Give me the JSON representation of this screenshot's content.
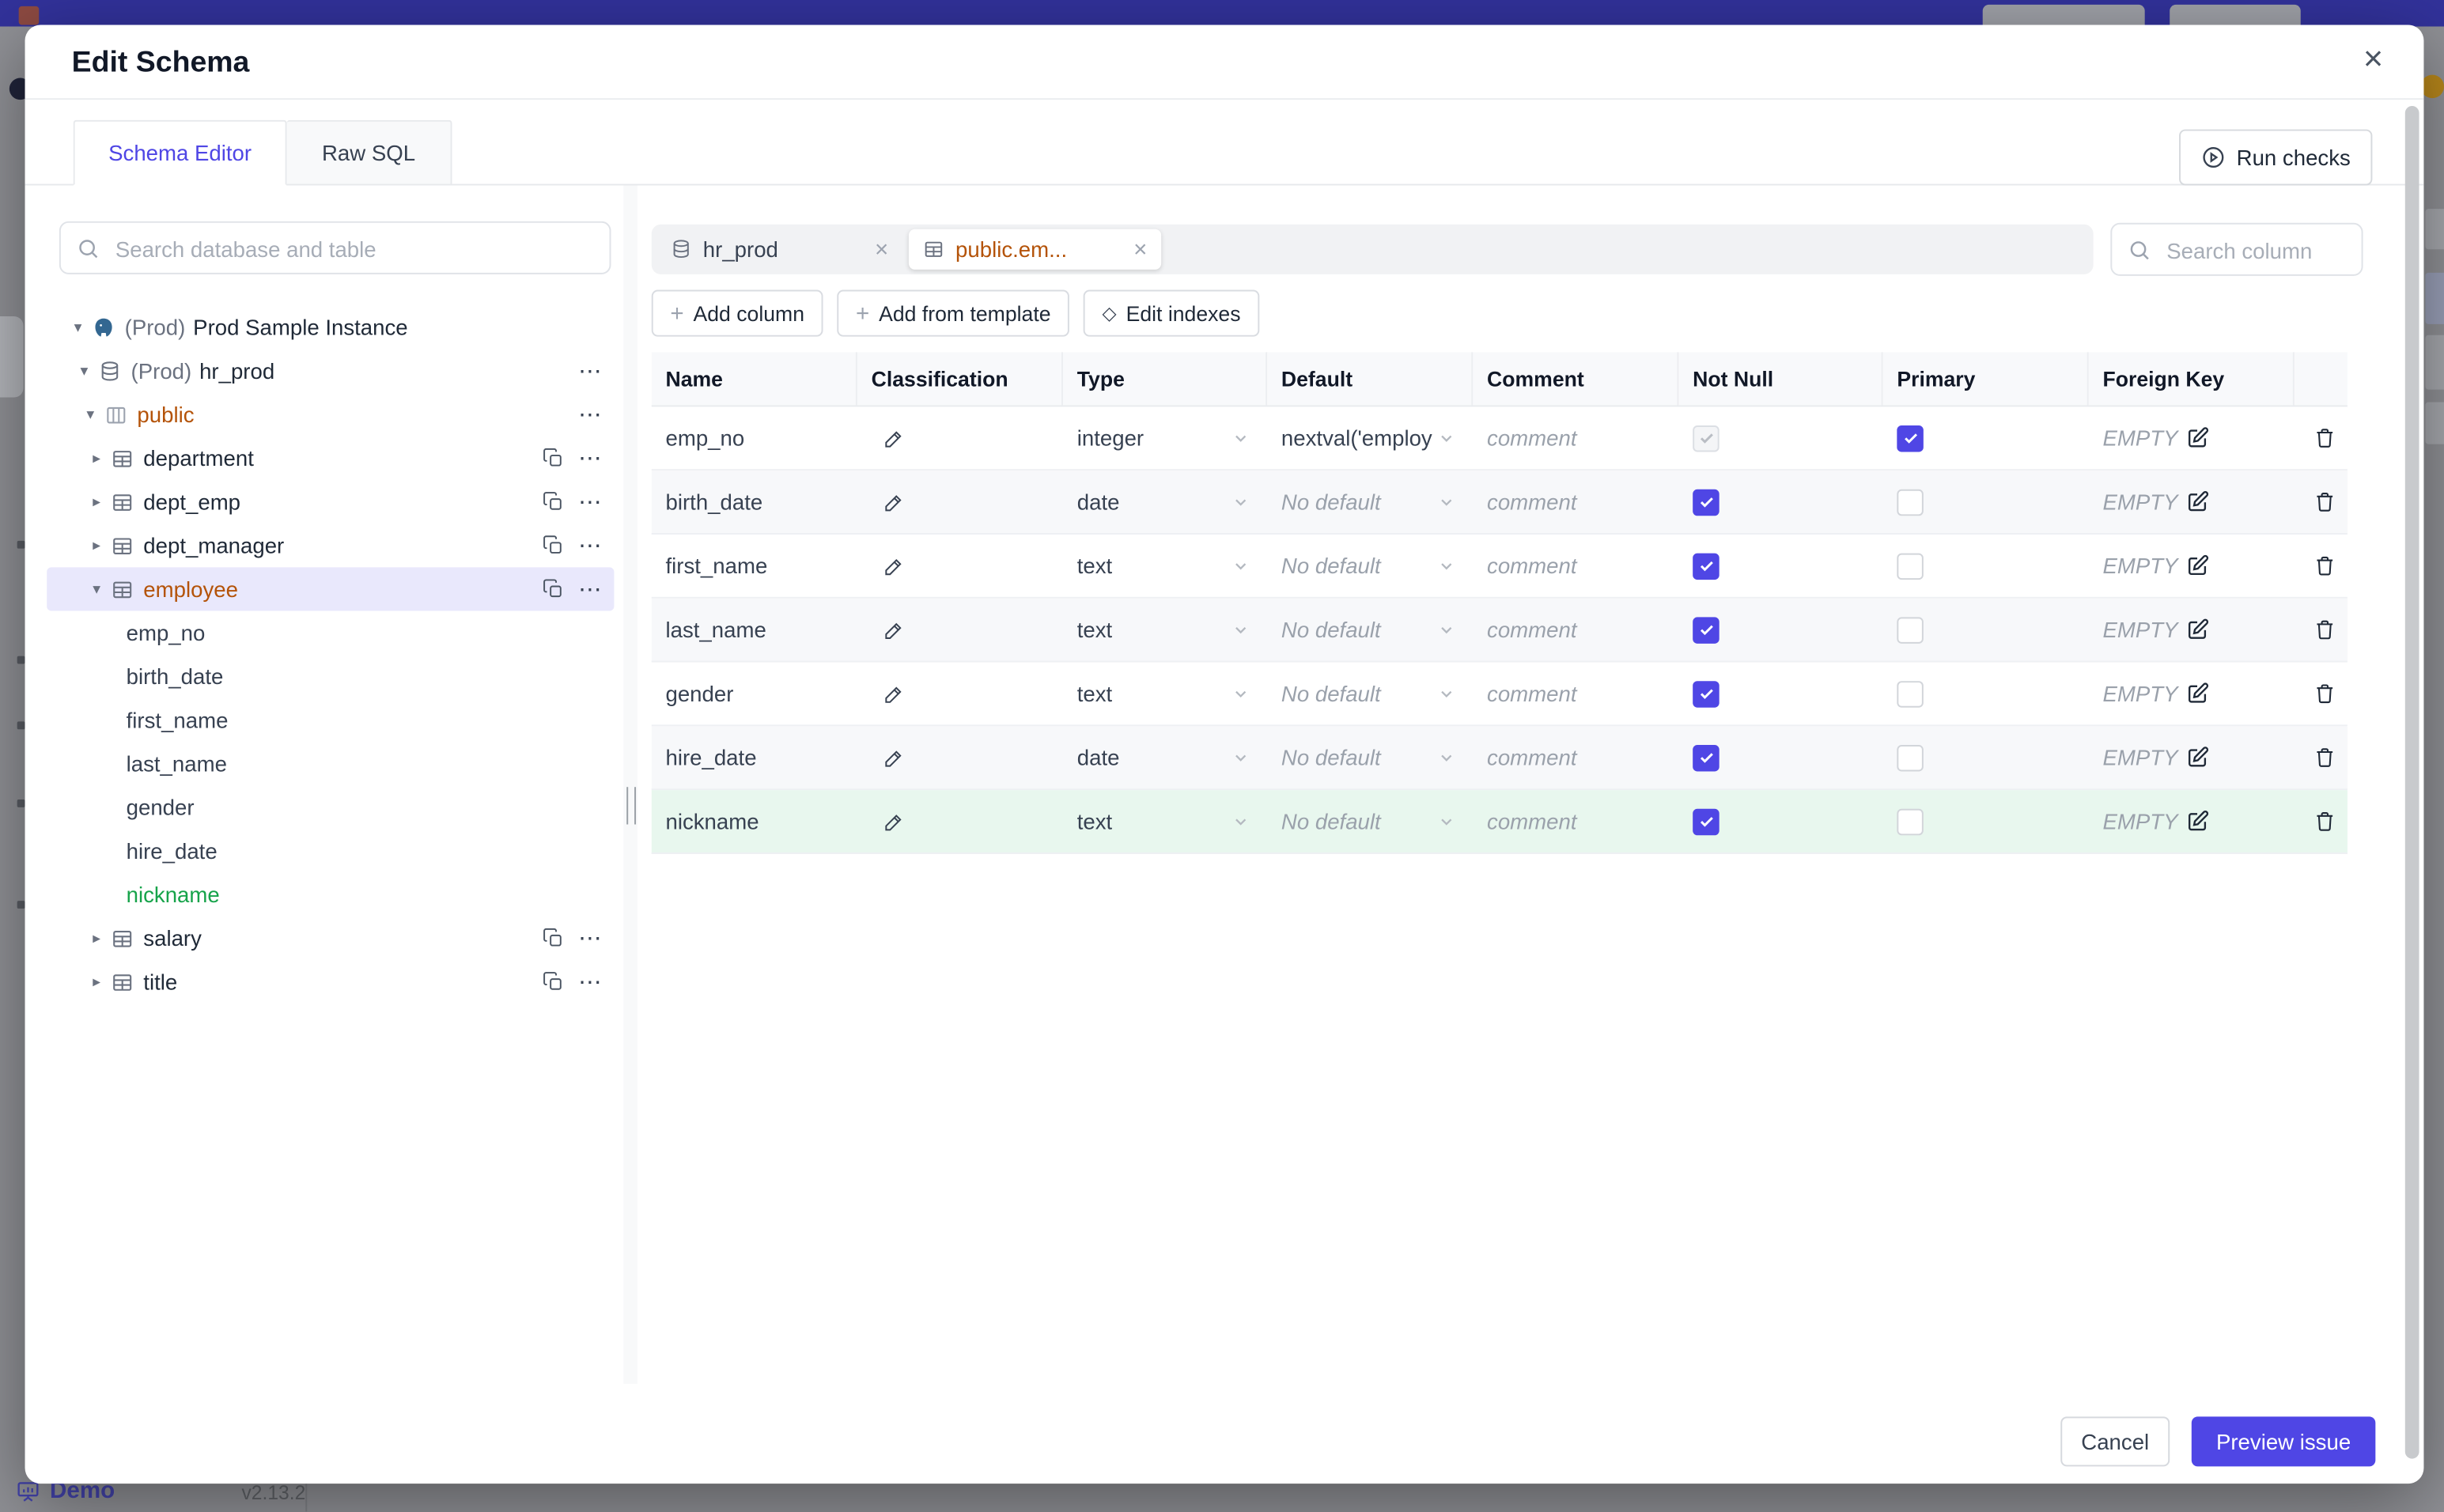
{
  "colors": {
    "accent": "#4f46e5",
    "topbar": "#32329b",
    "schema_open": "#b45309",
    "new_item": "#16a34a"
  },
  "icons": {
    "caret_down": "▾",
    "caret_right": "▸",
    "ellipsis": "⋯",
    "close": "×",
    "plus": "+",
    "diamond": "◇"
  },
  "backdrop": {
    "demo_label": "Demo",
    "version": "v2.13.2"
  },
  "modal": {
    "title": "Edit Schema",
    "tabs": [
      {
        "label": "Schema Editor"
      },
      {
        "label": "Raw SQL"
      }
    ],
    "run_checks": "Run checks",
    "sidebar_search_placeholder": "Search database and table",
    "search_column_placeholder": "Search column",
    "chips": [
      {
        "label": "hr_prod"
      },
      {
        "label": "public.em..."
      }
    ],
    "toolbar": {
      "add_column": "Add column",
      "add_from_template": "Add from template",
      "edit_indexes": "Edit indexes"
    },
    "footer": {
      "cancel": "Cancel",
      "preview_issue": "Preview issue"
    }
  },
  "sidebar_tree": [
    {
      "prefix": "(Prod)",
      "label": "Prod Sample Instance"
    },
    {
      "prefix": "(Prod)",
      "label": "hr_prod"
    },
    {
      "label": "public"
    },
    {
      "label": "department"
    },
    {
      "label": "dept_emp"
    },
    {
      "label": "dept_manager"
    },
    {
      "label": "employee"
    },
    {
      "label": "emp_no"
    },
    {
      "label": "birth_date"
    },
    {
      "label": "first_name"
    },
    {
      "label": "last_name"
    },
    {
      "label": "gender"
    },
    {
      "label": "hire_date"
    },
    {
      "label": "nickname"
    },
    {
      "label": "salary"
    },
    {
      "label": "title"
    }
  ],
  "table": {
    "headers": [
      "Name",
      "Classification",
      "Type",
      "Default",
      "Comment",
      "Not Null",
      "Primary",
      "Foreign Key"
    ],
    "rows": [
      {
        "name": "emp_no",
        "type": "integer",
        "default": "nextval('employ",
        "comment": "comment",
        "foreign_key": "EMPTY"
      },
      {
        "name": "birth_date",
        "type": "date",
        "default": "No default",
        "comment": "comment",
        "foreign_key": "EMPTY"
      },
      {
        "name": "first_name",
        "type": "text",
        "default": "No default",
        "comment": "comment",
        "foreign_key": "EMPTY"
      },
      {
        "name": "last_name",
        "type": "text",
        "default": "No default",
        "comment": "comment",
        "foreign_key": "EMPTY"
      },
      {
        "name": "gender",
        "type": "text",
        "default": "No default",
        "comment": "comment",
        "foreign_key": "EMPTY"
      },
      {
        "name": "hire_date",
        "type": "date",
        "default": "No default",
        "comment": "comment",
        "foreign_key": "EMPTY"
      },
      {
        "name": "nickname",
        "type": "text",
        "default": "No default",
        "comment": "comment",
        "foreign_key": "EMPTY"
      }
    ]
  }
}
